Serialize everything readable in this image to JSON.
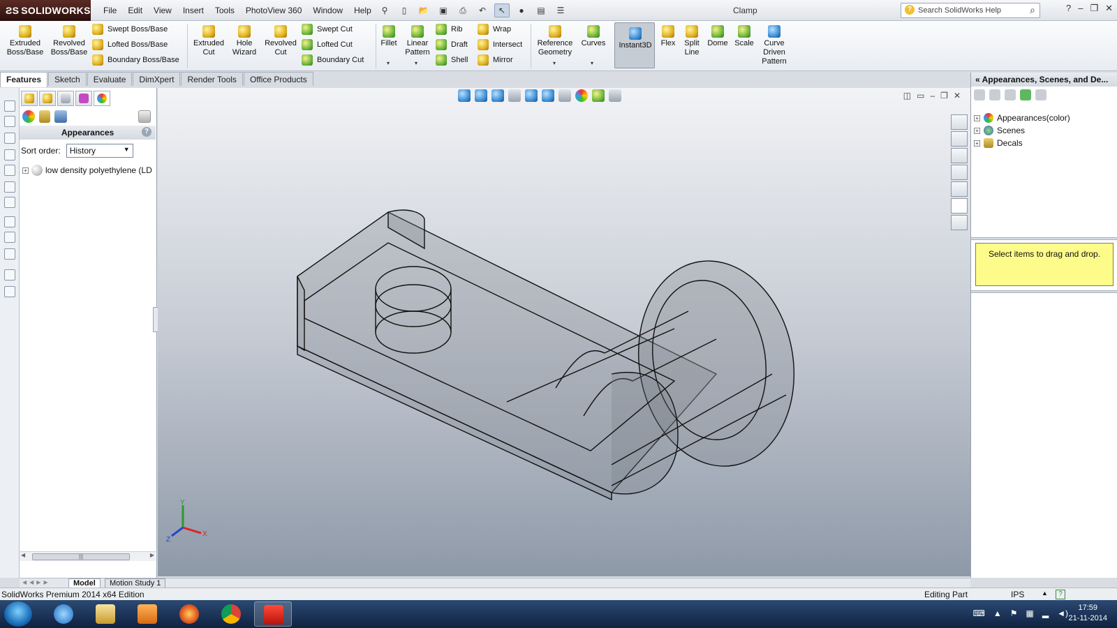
{
  "app": {
    "brand": "SOLIDWORKS",
    "document_title": "Clamp",
    "search_placeholder": "Search SolidWorks Help"
  },
  "menu": [
    "File",
    "Edit",
    "View",
    "Insert",
    "Tools",
    "PhotoView 360",
    "Window",
    "Help"
  ],
  "ribbon": {
    "extruded_boss": "Extruded Boss/Base",
    "revolved_boss": "Revolved Boss/Base",
    "swept_boss": "Swept Boss/Base",
    "lofted_boss": "Lofted Boss/Base",
    "boundary_boss": "Boundary Boss/Base",
    "extruded_cut": "Extruded Cut",
    "hole_wizard": "Hole Wizard",
    "revolved_cut": "Revolved Cut",
    "swept_cut": "Swept Cut",
    "lofted_cut": "Lofted Cut",
    "boundary_cut": "Boundary Cut",
    "fillet": "Fillet",
    "linear_pattern": "Linear Pattern",
    "rib": "Rib",
    "draft": "Draft",
    "shell": "Shell",
    "wrap": "Wrap",
    "intersect": "Intersect",
    "mirror": "Mirror",
    "reference_geometry": "Reference Geometry",
    "curves": "Curves",
    "instant3d": "Instant3D",
    "flex": "Flex",
    "split_line": "Split Line",
    "dome": "Dome",
    "scale": "Scale",
    "curve_driven_pattern": "Curve Driven Pattern"
  },
  "tabs": [
    "Features",
    "Sketch",
    "Evaluate",
    "DimXpert",
    "Render Tools",
    "Office Products"
  ],
  "left_panel": {
    "header": "Appearances",
    "help": "?",
    "sort_label": "Sort order:",
    "sort_value": "History",
    "item": "low density polyethylene (LD"
  },
  "right_pane": {
    "header": "Appearances, Scenes, and De...",
    "items": [
      "Appearances(color)",
      "Scenes",
      "Decals"
    ],
    "drop_hint": "Select items to drag and drop."
  },
  "triad": {
    "y": "Y",
    "x": "X",
    "z": "Z"
  },
  "bottom_tabs": [
    "Model",
    "Motion Study 1"
  ],
  "status": {
    "edition": "SolidWorks Premium 2014 x64 Edition",
    "mode": "Editing Part",
    "units": "IPS",
    "help_icon": "?"
  },
  "taskbar": {
    "time": "17:59",
    "date": "21-11-2014"
  }
}
